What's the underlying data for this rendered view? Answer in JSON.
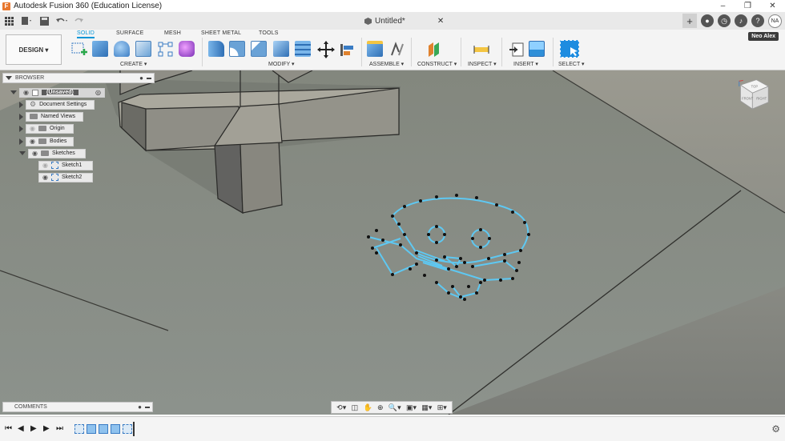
{
  "window": {
    "title": "Autodesk Fusion 360 (Education License)",
    "app_icon": "F",
    "minimize": "–",
    "maximize": "❐",
    "close": "✕"
  },
  "qat": {
    "doc_title": "Untitled*",
    "doc_close": "✕",
    "plus": "+",
    "avatar": "NA"
  },
  "ribbon": {
    "workspace": "DESIGN ▾",
    "tabs": [
      {
        "label": "SOLID",
        "active": true
      },
      {
        "label": "SURFACE",
        "active": false
      },
      {
        "label": "MESH",
        "active": false
      },
      {
        "label": "SHEET METAL",
        "active": false
      },
      {
        "label": "TOOLS",
        "active": false
      }
    ],
    "groups": {
      "create": "CREATE ▾",
      "modify": "MODIFY ▾",
      "assemble": "ASSEMBLE ▾",
      "construct": "CONSTRUCT ▾",
      "inspect": "INSPECT ▾",
      "insert": "INSERT ▾",
      "select": "SELECT ▾"
    },
    "user_name": "Neo Alex"
  },
  "browser": {
    "title": "BROWSER",
    "root": "(Unsaved)",
    "items": [
      "Document Settings",
      "Named Views",
      "Origin",
      "Bodies",
      "Sketches"
    ],
    "sketches": [
      "Sketch1",
      "Sketch2"
    ]
  },
  "comments": {
    "title": "COMMENTS"
  },
  "navcube": {
    "top": "TOP",
    "front": "FRONT",
    "right": "RIGHT"
  },
  "colors": {
    "accent": "#0696d7",
    "sketch": "#5ec8f2",
    "floor": "#8c8d86"
  }
}
